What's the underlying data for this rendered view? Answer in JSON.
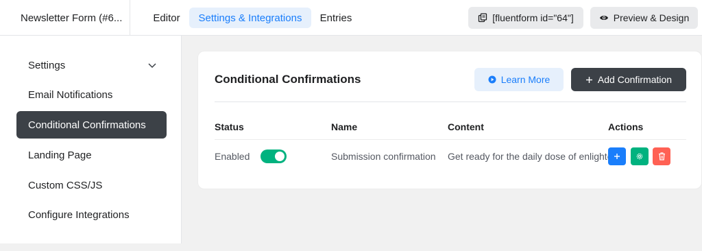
{
  "header": {
    "form_title": "Newsletter Form (#6...",
    "tabs": [
      {
        "label": "Editor"
      },
      {
        "label": "Settings & Integrations"
      },
      {
        "label": "Entries"
      }
    ],
    "shortcode_label": "[fluentform id=\"64\"]",
    "preview_label": "Preview & Design"
  },
  "sidebar": {
    "items": [
      {
        "label": "Settings"
      },
      {
        "label": "Email Notifications"
      },
      {
        "label": "Conditional Confirmations"
      },
      {
        "label": "Landing Page"
      },
      {
        "label": "Custom CSS/JS"
      },
      {
        "label": "Configure Integrations"
      }
    ]
  },
  "main": {
    "title": "Conditional Confirmations",
    "learn_more_label": "Learn More",
    "add_confirmation_label": "Add Confirmation",
    "columns": [
      "Status",
      "Name",
      "Content",
      "Actions"
    ],
    "rows": [
      {
        "status": "Enabled",
        "enabled": true,
        "name": "Submission confirmation",
        "content": "Get ready for the daily dose of enlightenment"
      }
    ]
  },
  "colors": {
    "accent": "#1a7efb",
    "dark": "#3c4147",
    "success": "#00b27f",
    "danger": "#ff6154"
  },
  "icons": {
    "shortcode": "copy-icon",
    "preview": "eye-icon",
    "learn_more": "play-circle-icon",
    "add": "plus-icon",
    "settings_chevron": "chevron-down-icon",
    "action_add": "plus-icon",
    "action_settings": "gear-icon",
    "action_delete": "trash-icon"
  }
}
